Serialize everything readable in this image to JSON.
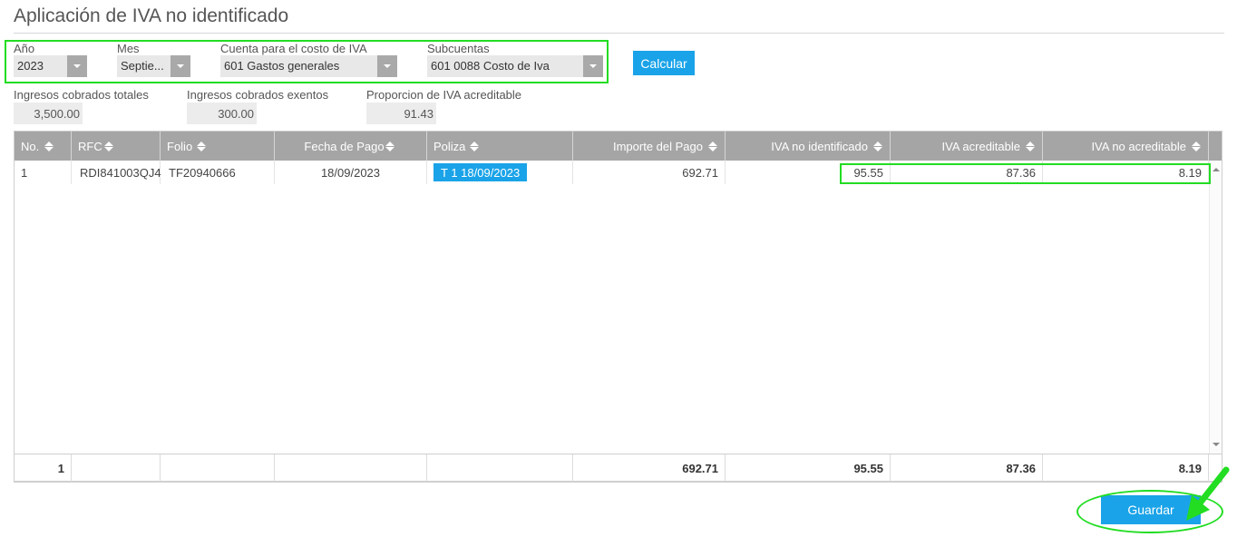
{
  "page": {
    "title": "Aplicación de IVA no identificado"
  },
  "filters": {
    "anio": {
      "label": "Año",
      "value": "2023"
    },
    "mes": {
      "label": "Mes",
      "value": "Septie..."
    },
    "cuenta": {
      "label": "Cuenta para el costo de IVA",
      "value": "601 Gastos generales"
    },
    "subcuentas": {
      "label": "Subcuentas",
      "value": "601 0088 Costo de Iva"
    },
    "calcular_label": "Calcular"
  },
  "summary": {
    "ingresos_totales": {
      "label": "Ingresos cobrados totales",
      "value": "3,500.00"
    },
    "ingresos_exentos": {
      "label": "Ingresos cobrados exentos",
      "value": "300.00"
    },
    "proporcion": {
      "label": "Proporcion de IVA acreditable",
      "value": "91.43"
    }
  },
  "table": {
    "columns": [
      "No.",
      "RFC",
      "Folio",
      "Fecha de Pago",
      "Poliza",
      "Importe del Pago",
      "IVA no identificado",
      "IVA acreditable",
      "IVA no acreditable"
    ],
    "rows": [
      {
        "no": "1",
        "rfc": "RDI841003QJ4",
        "folio": "TF20940666",
        "fecha_pago": "18/09/2023",
        "poliza": "T 1 18/09/2023",
        "importe": "692.71",
        "iva_no_identificado": "95.55",
        "iva_acreditable": "87.36",
        "iva_no_acreditable": "8.19"
      }
    ],
    "totals": {
      "count": "1",
      "importe": "692.71",
      "iva_no_identificado": "95.55",
      "iva_acreditable": "87.36",
      "iva_no_acreditable": "8.19"
    }
  },
  "actions": {
    "guardar_label": "Guardar"
  },
  "colors": {
    "accent": "#1aa3e8",
    "header_gray": "#a5a5a5",
    "annotation_green": "#22dd22"
  }
}
